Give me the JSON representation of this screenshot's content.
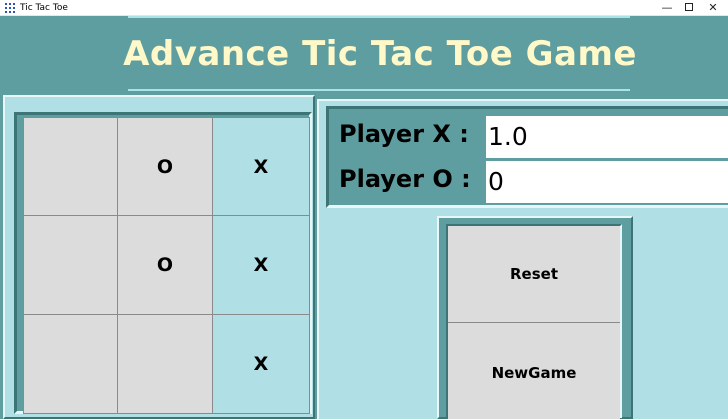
{
  "window": {
    "title": "Tic Tac Toe",
    "minimize": "—",
    "close": "✕"
  },
  "header": {
    "title": "Advance Tic Tac Toe Game"
  },
  "board": {
    "cells": [
      "",
      "O",
      "X",
      "",
      "O",
      "X",
      "",
      "",
      "X"
    ]
  },
  "scores": {
    "x_label": "Player X :",
    "x_value": "1.0",
    "o_label": "Player O :",
    "o_value": "0"
  },
  "buttons": {
    "reset": "Reset",
    "new_game": "NewGame"
  },
  "colors": {
    "teal": "#5f9ea0",
    "light_blue": "#b0dfe5",
    "title_text": "#fff8c8",
    "cell_gray": "#dcdcdc"
  }
}
